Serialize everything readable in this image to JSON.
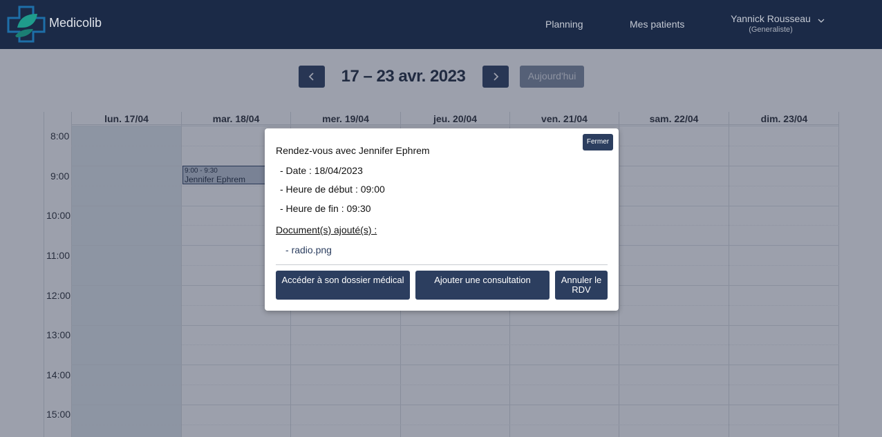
{
  "navbar": {
    "brand": "Medicolib",
    "links": [
      "Planning",
      "Mes patients"
    ],
    "user_name": "Yannick Rousseau",
    "user_role": "(Generaliste)"
  },
  "week": {
    "title": "17 – 23 avr. 2023",
    "today_label": "Aujourd'hui"
  },
  "calendar": {
    "days": [
      "lun. 17/04",
      "mar. 18/04",
      "mer. 19/04",
      "jeu. 20/04",
      "ven. 21/04",
      "sam. 22/04",
      "dim. 23/04"
    ],
    "hours": [
      "8:00",
      "9:00",
      "10:00",
      "11:00",
      "12:00",
      "13:00",
      "14:00",
      "15:00"
    ],
    "event": {
      "time": "9:00 - 9:30",
      "title": "Jennifer Ephrem"
    }
  },
  "modal": {
    "close_label": "Fermer",
    "title": "Rendez-vous avec Jennifer Ephrem",
    "date": "- Date : 18/04/2023",
    "start": "- Heure de début : 09:00",
    "end": "- Heure de fin : 09:30",
    "docs_label": "Document(s) ajouté(s) :",
    "doc_dash": "-",
    "doc_name": "radio.png",
    "btn_dossier": "Accéder à son dossier médical",
    "btn_consultation": "Ajouter une consultation",
    "btn_annuler": "Annuler le RDV"
  },
  "colors": {
    "navbar": "#1b2a47",
    "primary": "#2c3e5f",
    "logo_teal": "#1f9c8c",
    "logo_blue": "#1e6fa8"
  }
}
